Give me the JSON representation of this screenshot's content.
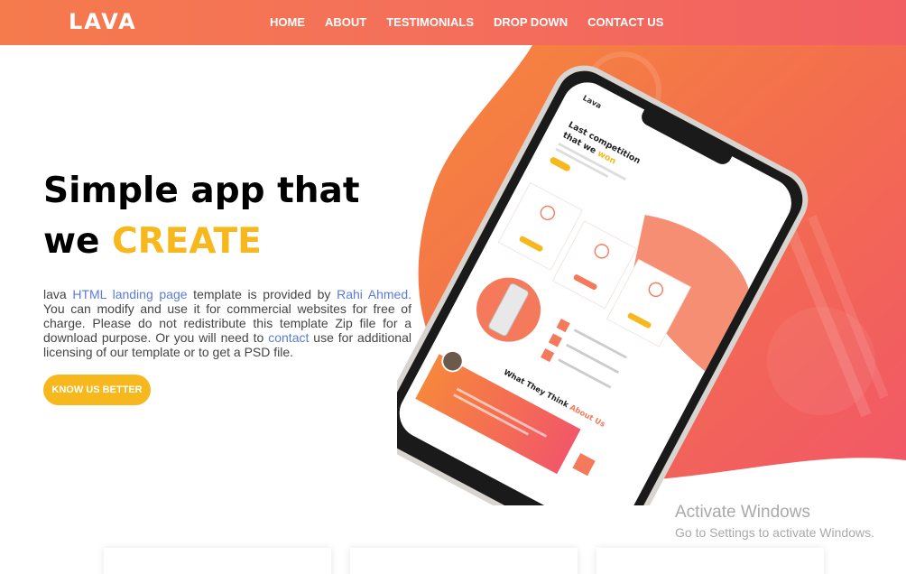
{
  "header": {
    "logo": "LAVA",
    "nav": [
      "HOME",
      "ABOUT",
      "TESTIMONIALS",
      "DROP DOWN",
      "CONTACT US"
    ]
  },
  "hero": {
    "title_line1": "Simple app that",
    "title_line2_prefix": "we",
    "title_line2_accent": "CREATE",
    "desc_1": "lava ",
    "desc_link1": "HTML landing page",
    "desc_2": " template is provided by ",
    "desc_link2": "Rahi Ahmed.",
    "desc_3": " You can modify and use it for commercial websites for free of charge. Please do not redistribute this template Zip file for a download purpose. Or you will need to ",
    "desc_link3": "contact",
    "desc_4": " use for additional licensing of our template or to get a PSD file.",
    "cta": "KNOW US BETTER"
  },
  "phone_screen": {
    "brand": "Lava",
    "headline_1": "Last competition",
    "headline_2_prefix": "that we ",
    "headline_2_accent": "won",
    "section_title_prefix": "What They Think ",
    "section_title_accent": "About Us"
  },
  "watermark": {
    "title": "Activate Windows",
    "subtitle": "Go to Settings to activate Windows."
  },
  "colors": {
    "primary_gradient_start": "#f57a4c",
    "primary_gradient_end": "#f25f62",
    "accent": "#f6b81c",
    "link": "#5a7bd8"
  }
}
